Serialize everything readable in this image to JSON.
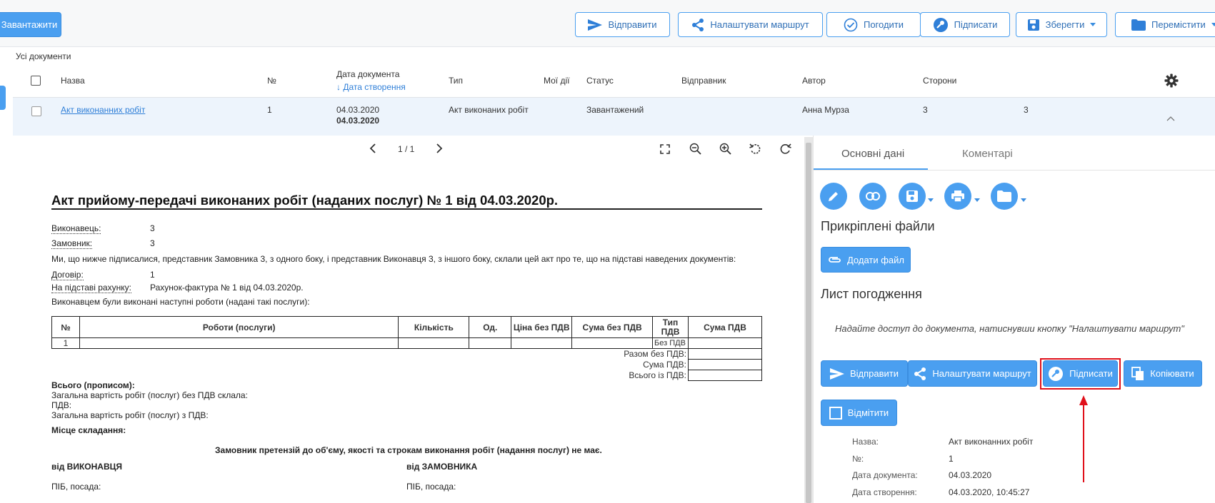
{
  "toolbar": {
    "upload_label": "Завантажити",
    "send_label": "Відправити",
    "route_label": "Налаштувати маршрут",
    "approve_label": "Погодити",
    "sign_label": "Підписати",
    "save_label": "Зберегти",
    "move_label": "Перемістити"
  },
  "breadcrumb": "Усі документи",
  "table": {
    "headers": {
      "name": "Назва",
      "number": "№",
      "doc_date": "Дата документа",
      "created_sort": "↓ Дата створення",
      "type": "Тип",
      "my_actions": "Мої дії",
      "status": "Статус",
      "sender": "Відправник",
      "author": "Автор",
      "parties": "Сторони"
    },
    "row": {
      "name": "Акт виконанних робіт",
      "number": "1",
      "doc_date": "04.03.2020",
      "created": "04.03.2020",
      "type": "Акт виконаних робіт",
      "status": "Завантажений",
      "author": "Анна Мурза",
      "parties": "3",
      "extra": "3"
    }
  },
  "viewer": {
    "page_indicator": "1 / 1"
  },
  "document": {
    "title": "Акт прийому-передачі виконаних робіт (наданих послуг) № 1 від 04.03.2020р.",
    "executor_label": "Виконавець:",
    "executor_value": "3",
    "customer_label": "Замовник:",
    "customer_value": "3",
    "intro": "Ми, що нижче підписалися, представник Замовника 3, з одного боку, і представник Виконавця 3, з іншого боку, склали цей акт про те, що на підставі наведених документів:",
    "contract_label": "Договір:",
    "contract_value": "1",
    "invoice_label": "На підставі рахунку:",
    "invoice_value": "Рахунок-фактура № 1 від 04.03.2020р.",
    "works_intro": "Виконавцем були виконані наступні роботи (надані такі послуги):",
    "table_headers": [
      "№",
      "Роботи (послуги)",
      "Кількість",
      "Од.",
      "Ціна без ПДВ",
      "Сума без ПДВ",
      "Тип ПДВ",
      "Сума ПДВ"
    ],
    "row_number": "1",
    "row_vat_type": "Без ПДВ",
    "total_without_vat": "Разом без ПДВ:",
    "vat_sum": "Сума ПДВ:",
    "total_with_vat": "Всього із ПДВ:",
    "total_words": "Всього (прописом):",
    "total_cost_without_vat": "Загальна вартість робіт (послуг) без ПДВ склала:",
    "vat": "ПДВ:",
    "total_cost_with_vat": "Загальна вартість робіт (послуг) з ПДВ:",
    "place": "Місце складання:",
    "no_claims": "Замовник претензій до об'єму, якості та строкам виконання робіт (надання послуг) не має.",
    "from_executor": "від ВИКОНАВЦЯ",
    "from_customer": "від ЗАМОВНИКА",
    "name_position_1": "ПІБ, посада:",
    "name_position_2": "ПІБ, посада:"
  },
  "panel": {
    "tab_main": "Основні дані",
    "tab_comments": "Коментарі",
    "attached_files": "Прикріплені файли",
    "add_file": "Додати файл",
    "approval_sheet": "Лист погодження",
    "approval_hint": "Надайте доступ до документа, натиснувши кнопку \"Налаштувати маршрут\"",
    "send": "Відправити",
    "route": "Налаштувати маршрут",
    "sign": "Підписати",
    "copy": "Копіювати",
    "mark": "Відмітити",
    "meta": [
      {
        "label": "Назва:",
        "value": "Акт виконанних робіт"
      },
      {
        "label": "№:",
        "value": "1"
      },
      {
        "label": "Дата документа:",
        "value": "04.03.2020"
      },
      {
        "label": "Дата створення:",
        "value": "04.03.2020, 10:45:27"
      }
    ]
  },
  "colors": {
    "accent": "#4a9ff0",
    "highlight": "#e0101a"
  }
}
